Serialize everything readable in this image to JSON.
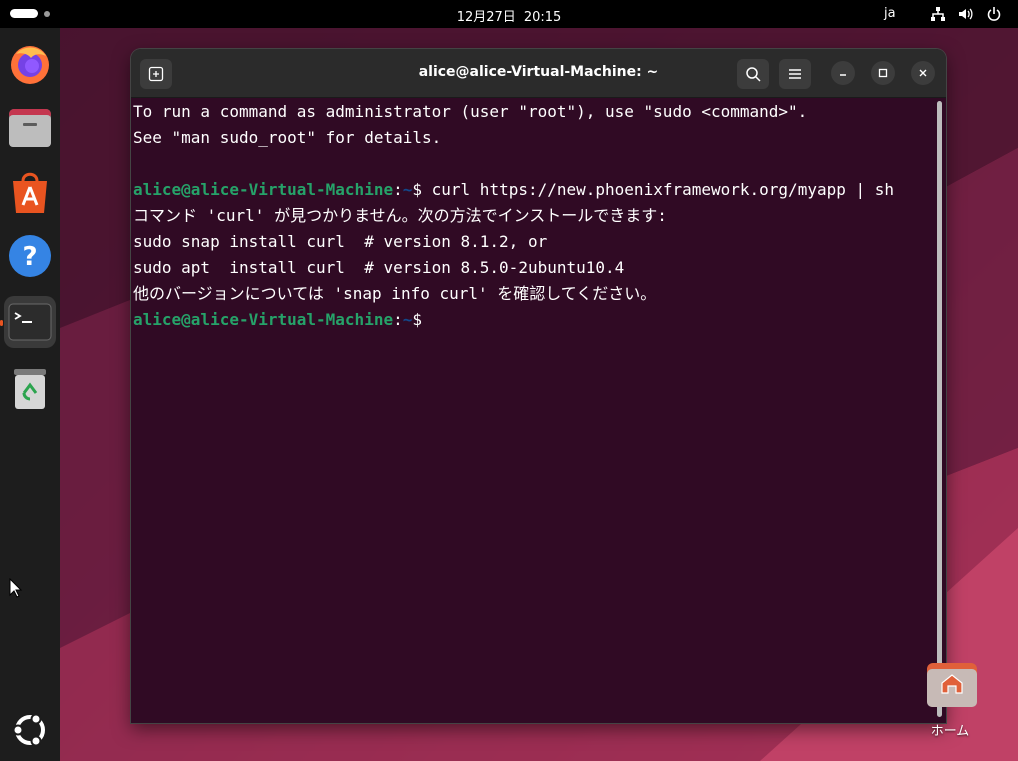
{
  "topbar": {
    "date": "12月27日",
    "time": "20:15",
    "input_language": "ja",
    "icons": [
      "network-icon",
      "volume-icon",
      "power-icon"
    ]
  },
  "dock": {
    "apps": [
      {
        "name": "Firefox",
        "icon": "firefox-icon"
      },
      {
        "name": "Files",
        "icon": "files-icon"
      },
      {
        "name": "App Center",
        "icon": "app-center-icon"
      },
      {
        "name": "Help",
        "icon": "help-icon"
      },
      {
        "name": "Terminal",
        "icon": "terminal-icon",
        "active": true
      },
      {
        "name": "Trash",
        "icon": "trash-icon"
      }
    ],
    "show_apps_icon": "ubuntu-logo-icon"
  },
  "terminal": {
    "title": "alice@alice-Virtual-Machine: ~",
    "lines": [
      "To run a command as administrator (user \"root\"), use \"sudo <command>\".",
      "See \"man sudo_root\" for details.",
      "",
      "",
      "コマンド 'curl' が見つかりません。次の方法でインストールできます:",
      "sudo snap install curl  # version 8.1.2, or",
      "sudo apt  install curl  # version 8.5.0-2ubuntu10.4",
      "他のバージョンについては 'snap info curl' を確認してください。"
    ],
    "prompt": {
      "user_host": "alice@alice-Virtual-Machine",
      "separator": ":",
      "path": "~",
      "symbol": "$ "
    },
    "command": "curl https://new.phoenixframework.org/myapp | sh",
    "colors": {
      "background": "#300a24",
      "prompt_user": "#26a269",
      "prompt_path": "#12488b",
      "text": "#ffffff"
    }
  },
  "desktop": {
    "home_label": "ホーム"
  }
}
